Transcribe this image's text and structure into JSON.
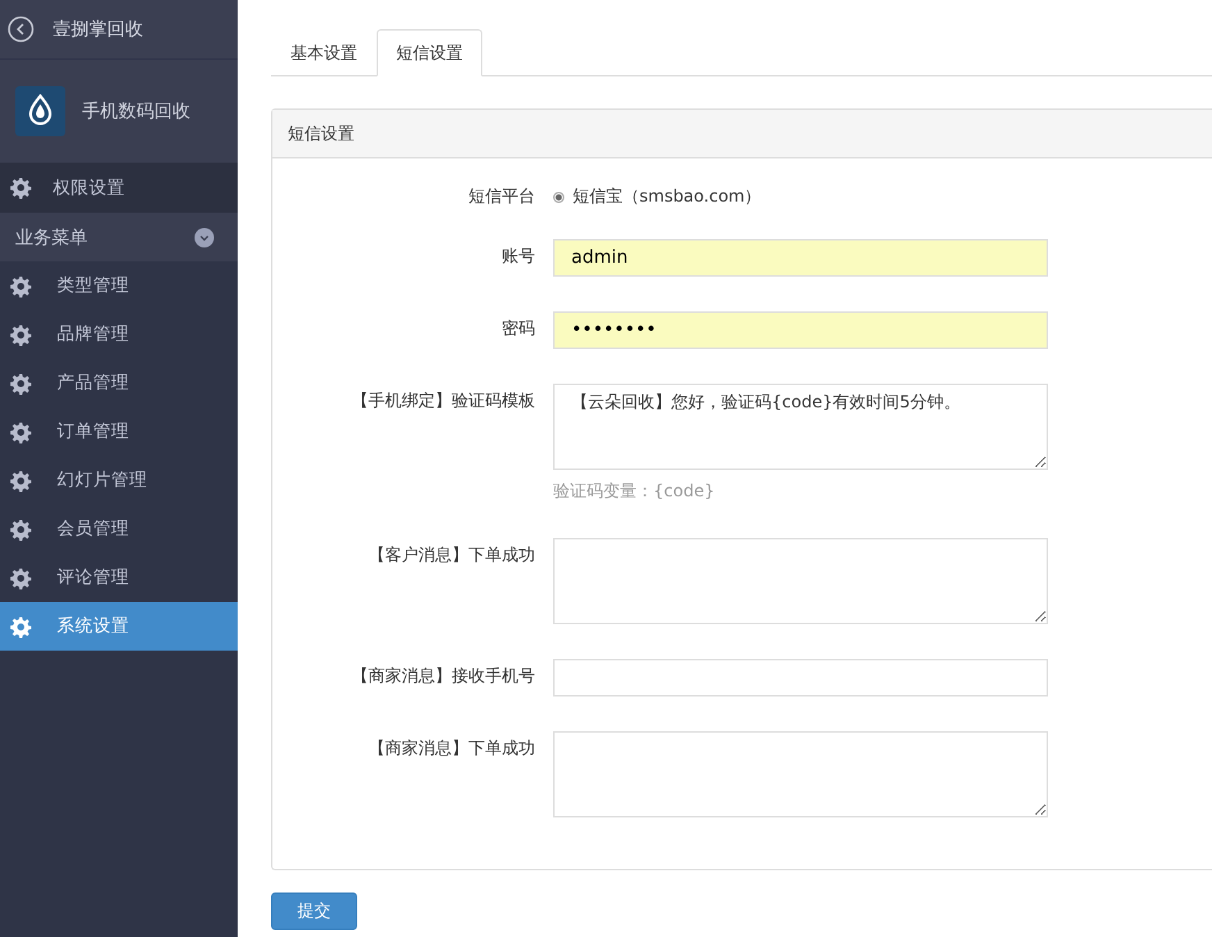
{
  "sidebar": {
    "back_title": "壹捌掌回收",
    "brand": "手机数码回收",
    "top_items": [
      {
        "label": "权限设置",
        "selected": false
      }
    ],
    "section": {
      "label": "业务菜单",
      "expanded": true
    },
    "items": [
      {
        "label": "类型管理",
        "selected": false
      },
      {
        "label": "品牌管理",
        "selected": false
      },
      {
        "label": "产品管理",
        "selected": false
      },
      {
        "label": "订单管理",
        "selected": false
      },
      {
        "label": "幻灯片管理",
        "selected": false
      },
      {
        "label": "会员管理",
        "selected": false
      },
      {
        "label": "评论管理",
        "selected": false
      },
      {
        "label": "系统设置",
        "selected": true
      }
    ]
  },
  "tabs": [
    {
      "label": "基本设置",
      "selected": false
    },
    {
      "label": "短信设置",
      "selected": true
    }
  ],
  "panel": {
    "title": "短信设置",
    "fields": [
      {
        "kind": "radio",
        "label": "短信平台",
        "option": "短信宝（smsbao.com）",
        "checked": true
      },
      {
        "kind": "input",
        "label": "账号",
        "value": "admin",
        "autofilled": true
      },
      {
        "kind": "input",
        "label": "密码",
        "value": "••••••••",
        "autofilled": true
      },
      {
        "kind": "textarea",
        "label": "【手机绑定】验证码模板",
        "value": "【云朵回收】您好，验证码{code}有效时间5分钟。",
        "hint": "验证码变量：{code}"
      },
      {
        "kind": "textarea",
        "label": "【客户消息】下单成功"
      },
      {
        "kind": "input",
        "label": "【商家消息】接收手机号",
        "autofilled": false
      },
      {
        "kind": "textarea",
        "label": "【商家消息】下单成功"
      }
    ]
  },
  "submit": "提交"
}
